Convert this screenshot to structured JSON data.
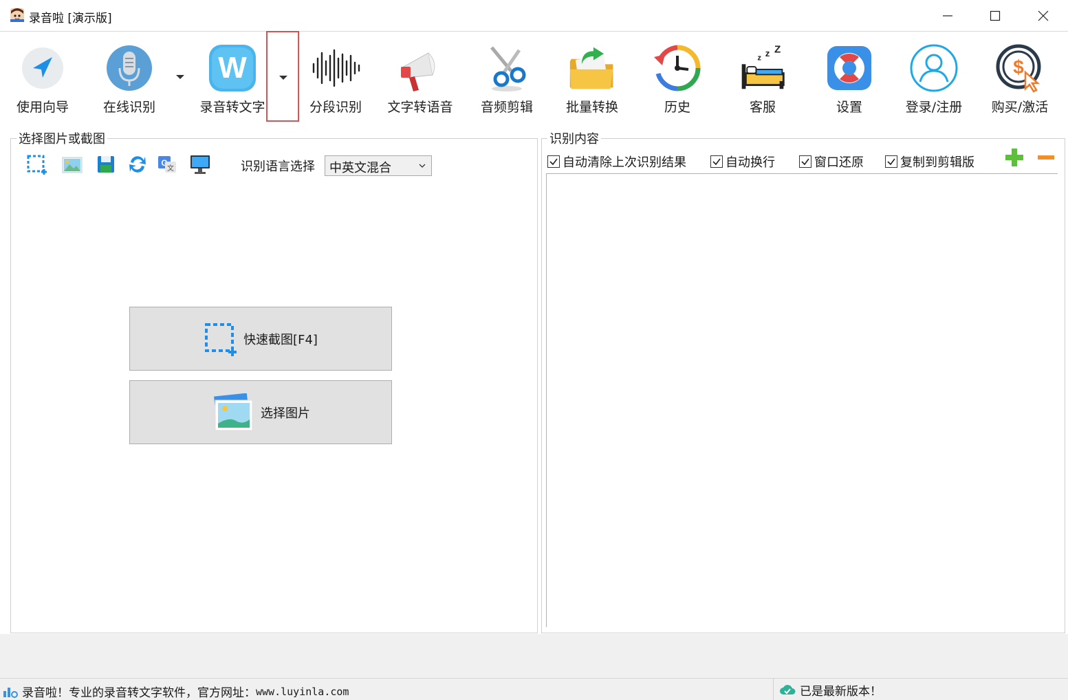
{
  "window": {
    "title": "录音啦 [演示版]"
  },
  "toolbar": {
    "items": [
      {
        "label": "使用向导",
        "icon": "navigation-arrow-icon"
      },
      {
        "label": "在线识别",
        "icon": "microphone-icon"
      },
      {
        "label": "录音转文字",
        "icon": "w-app-icon"
      },
      {
        "label": "分段识别",
        "icon": "waveform-icon"
      },
      {
        "label": "文字转语音",
        "icon": "megaphone-icon"
      },
      {
        "label": "音频剪辑",
        "icon": "scissors-icon"
      },
      {
        "label": "批量转换",
        "icon": "folder-icon"
      },
      {
        "label": "历史",
        "icon": "clock-history-icon"
      },
      {
        "label": "客服",
        "icon": "bed-sleep-icon"
      },
      {
        "label": "设置",
        "icon": "lifebuoy-icon"
      },
      {
        "label": "登录/注册",
        "icon": "user-icon"
      },
      {
        "label": "购买/激活",
        "icon": "dollar-cursor-icon"
      }
    ]
  },
  "left_panel": {
    "title": "选择图片或截图",
    "lang_label": "识别语言选择",
    "lang_value": "中英文混合",
    "quick_capture_label": "快速截图[F4]",
    "select_image_label": "选择图片"
  },
  "right_panel": {
    "title": "识别内容",
    "checkboxes": [
      {
        "label": "自动清除上次识别结果",
        "checked": true
      },
      {
        "label": "自动换行",
        "checked": true
      },
      {
        "label": "窗口还原",
        "checked": true
      },
      {
        "label": "复制到剪辑版",
        "checked": true
      }
    ]
  },
  "status": {
    "left_prefix": "录音啦！专业的录音转文字软件，官方网址：",
    "left_url": "www.luyinla.com",
    "right": "已是最新版本！"
  },
  "colors": {
    "accent_blue": "#1e8fe6",
    "highlight_red": "#e05050",
    "plus_green": "#5cc03a",
    "minus_orange": "#f0902a"
  }
}
